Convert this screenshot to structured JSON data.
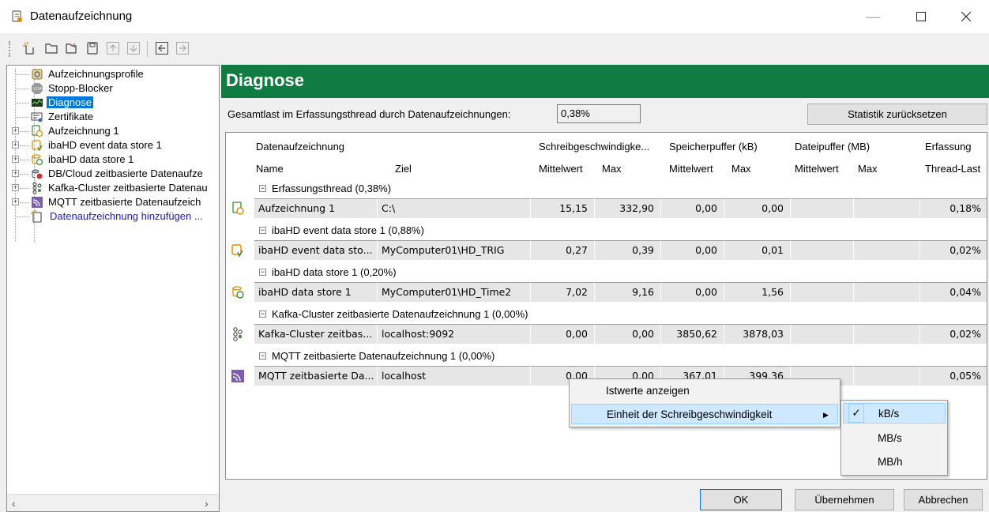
{
  "window": {
    "title": "Datenaufzeichnung"
  },
  "tree": {
    "items": [
      {
        "label": "Aufzeichnungsprofile"
      },
      {
        "label": "Stopp-Blocker"
      },
      {
        "label": "Diagnose"
      },
      {
        "label": "Zertifikate"
      },
      {
        "label": "Aufzeichnung 1"
      },
      {
        "label": "ibaHD event data store 1"
      },
      {
        "label": "ibaHD data store 1"
      },
      {
        "label": "DB/Cloud zeitbasierte Datenaufze"
      },
      {
        "label": "Kafka-Cluster zeitbasierte Datenau"
      },
      {
        "label": "MQTT zeitbasierte Datenaufzeich"
      },
      {
        "label": "Datenaufzeichnung hinzufügen ..."
      }
    ],
    "selected_index": 2
  },
  "diagnose": {
    "header": "Diagnose",
    "load_label": "Gesamtlast im Erfassungsthread durch Datenaufzeichnungen:",
    "load_value": "0,38%",
    "reset_button": "Statistik zurücksetzen"
  },
  "grid": {
    "headers_top": {
      "recording": "Datenaufzeichnung",
      "write_speed": "Schreibgeschwindigke...",
      "memory_buffer": "Speicherpuffer (kB)",
      "file_buffer": "Dateipuffer (MB)",
      "capture": "Erfassung"
    },
    "headers_sub": {
      "name": "Name",
      "target": "Ziel",
      "ws_avg": "Mittelwert",
      "ws_max": "Max",
      "mb_avg": "Mittelwert",
      "mb_max": "Max",
      "fb_avg": "Mittelwert",
      "fb_max": "Max",
      "thread_load": "Thread-Last"
    },
    "groups": [
      {
        "title": "Erfassungsthread (0,38%)",
        "row": {
          "name": "Aufzeichnung 1",
          "target": "C:\\",
          "ws_avg": "15,15",
          "ws_max": "332,90",
          "mb_avg": "0,00",
          "mb_max": "0,00",
          "fb_avg": "",
          "fb_max": "",
          "load": "0,18%"
        }
      },
      {
        "title": "ibaHD event data store 1 (0,88%)",
        "row": {
          "name": "ibaHD event data sto...",
          "target": "MyComputer01\\HD_TRIG",
          "ws_avg": "0,27",
          "ws_max": "0,39",
          "mb_avg": "0,00",
          "mb_max": "0,01",
          "fb_avg": "",
          "fb_max": "",
          "load": "0,02%"
        }
      },
      {
        "title": "ibaHD data store 1 (0,20%)",
        "row": {
          "name": "ibaHD data store 1",
          "target": "MyComputer01\\HD_Time2",
          "ws_avg": "7,02",
          "ws_max": "9,16",
          "mb_avg": "0,00",
          "mb_max": "1,56",
          "fb_avg": "",
          "fb_max": "",
          "load": "0,04%"
        }
      },
      {
        "title": "Kafka-Cluster zeitbasierte Datenaufzeichnung 1 (0,00%)",
        "row": {
          "name": "Kafka-Cluster zeitbas...",
          "target": "localhost:9092",
          "ws_avg": "0,00",
          "ws_max": "0,00",
          "mb_avg": "3850,62",
          "mb_max": "3878,03",
          "fb_avg": "",
          "fb_max": "",
          "load": "0,02%"
        }
      },
      {
        "title": "MQTT zeitbasierte Datenaufzeichnung 1 (0,00%)",
        "row": {
          "name": "MQTT zeitbasierte Da...",
          "target": "localhost",
          "ws_avg": "0,00",
          "ws_max": "0,00",
          "mb_avg": "367,01",
          "mb_max": "399,36",
          "fb_avg": "",
          "fb_max": "",
          "load": "0,05%"
        }
      }
    ]
  },
  "context_menu": {
    "items": [
      "Istwerte anzeigen",
      "Einheit der Schreibgeschwindigkeit"
    ],
    "submenu_arrow": "▶"
  },
  "submenu": {
    "items": [
      "kB/s",
      "MB/s",
      "MB/h"
    ],
    "checked": "kB/s",
    "check_glyph": "✓"
  },
  "buttons": {
    "ok": "OK",
    "apply": "Übernehmen",
    "cancel": "Abbrechen"
  },
  "colors": {
    "accent_green": "#107c41",
    "selection_blue": "#0078d7",
    "link_blue": "#1a1ad0"
  }
}
